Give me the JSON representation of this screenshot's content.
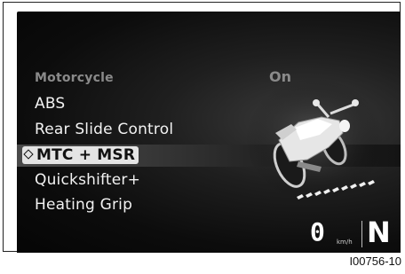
{
  "menu": {
    "header": "Motorcycle",
    "header_status": "On",
    "items": [
      {
        "label": "ABS"
      },
      {
        "label": "Rear Slide Control"
      },
      {
        "label": "MTC + MSR",
        "selected": true
      },
      {
        "label": "Quickshifter+"
      },
      {
        "label": "Heating Grip"
      }
    ]
  },
  "status_bar": {
    "speed": "0",
    "speed_unit": "km/h",
    "gear": "N"
  },
  "figure_id": "I00756-10",
  "icons": {
    "selected_marker": "diamond-marker-icon",
    "vehicle_illustration": "motorcycle-icon"
  },
  "colors": {
    "screen_background": "#111111",
    "text": "#f2f2f2",
    "muted_text": "#8a8a8a",
    "highlight": "#e4e4e4"
  }
}
